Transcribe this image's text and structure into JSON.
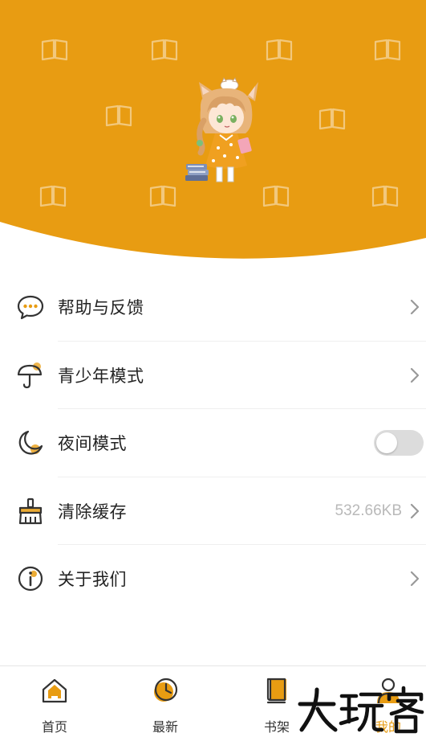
{
  "theme": {
    "accent": "#E89C12",
    "header_bg": "#E89C12",
    "icon_stroke": "#333333",
    "toggle_off": "#DCDCDC"
  },
  "header": {
    "mascot": "anime-girl-with-books"
  },
  "menu": {
    "items": [
      {
        "label": "帮助与反馈",
        "icon": "chat-bubble-icon",
        "trailing": "chevron"
      },
      {
        "label": "青少年模式",
        "icon": "umbrella-icon",
        "trailing": "chevron"
      },
      {
        "label": "夜间模式",
        "icon": "moon-icon",
        "trailing": "toggle",
        "toggle_on": false
      },
      {
        "label": "清除缓存",
        "icon": "broom-icon",
        "trailing": "chevron",
        "value": "532.66KB"
      },
      {
        "label": "关于我们",
        "icon": "info-icon",
        "trailing": "chevron"
      }
    ]
  },
  "bottom_nav": {
    "items": [
      {
        "label": "首页",
        "icon": "home-icon",
        "active": false
      },
      {
        "label": "最新",
        "icon": "clock-icon",
        "active": false
      },
      {
        "label": "书架",
        "icon": "book-icon",
        "active": false
      },
      {
        "label": "我的",
        "icon": "user-icon",
        "active": true
      }
    ]
  },
  "watermark": {
    "text": "大玩客"
  }
}
